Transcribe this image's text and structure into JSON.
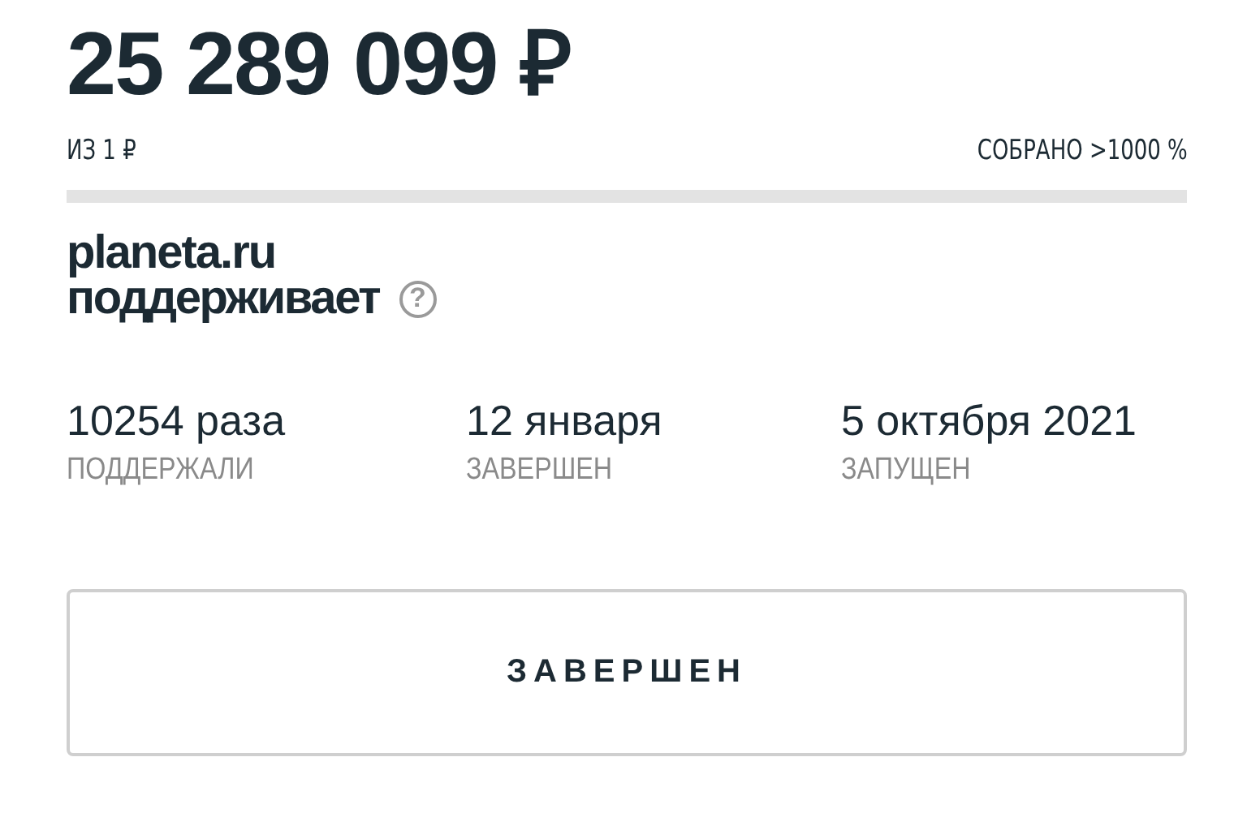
{
  "amount": "25 289 099 ₽",
  "goal": "ИЗ 1 ₽",
  "collected": "СОБРАНО >1000 %",
  "progress": {
    "level": 1
  },
  "sponsor": {
    "brand": "planeta.ru",
    "caption": "поддерживает",
    "help_icon": "?"
  },
  "stats": [
    {
      "value": "10254 раза",
      "label": "ПОДДЕРЖАЛИ"
    },
    {
      "value": "12 января",
      "label": "ЗАВЕРШЕН"
    },
    {
      "value": "5 октября 2021",
      "label": "ЗАПУЩЕН"
    }
  ],
  "status_button": {
    "label": "ЗАВЕРШЕН",
    "disabled": true
  }
}
